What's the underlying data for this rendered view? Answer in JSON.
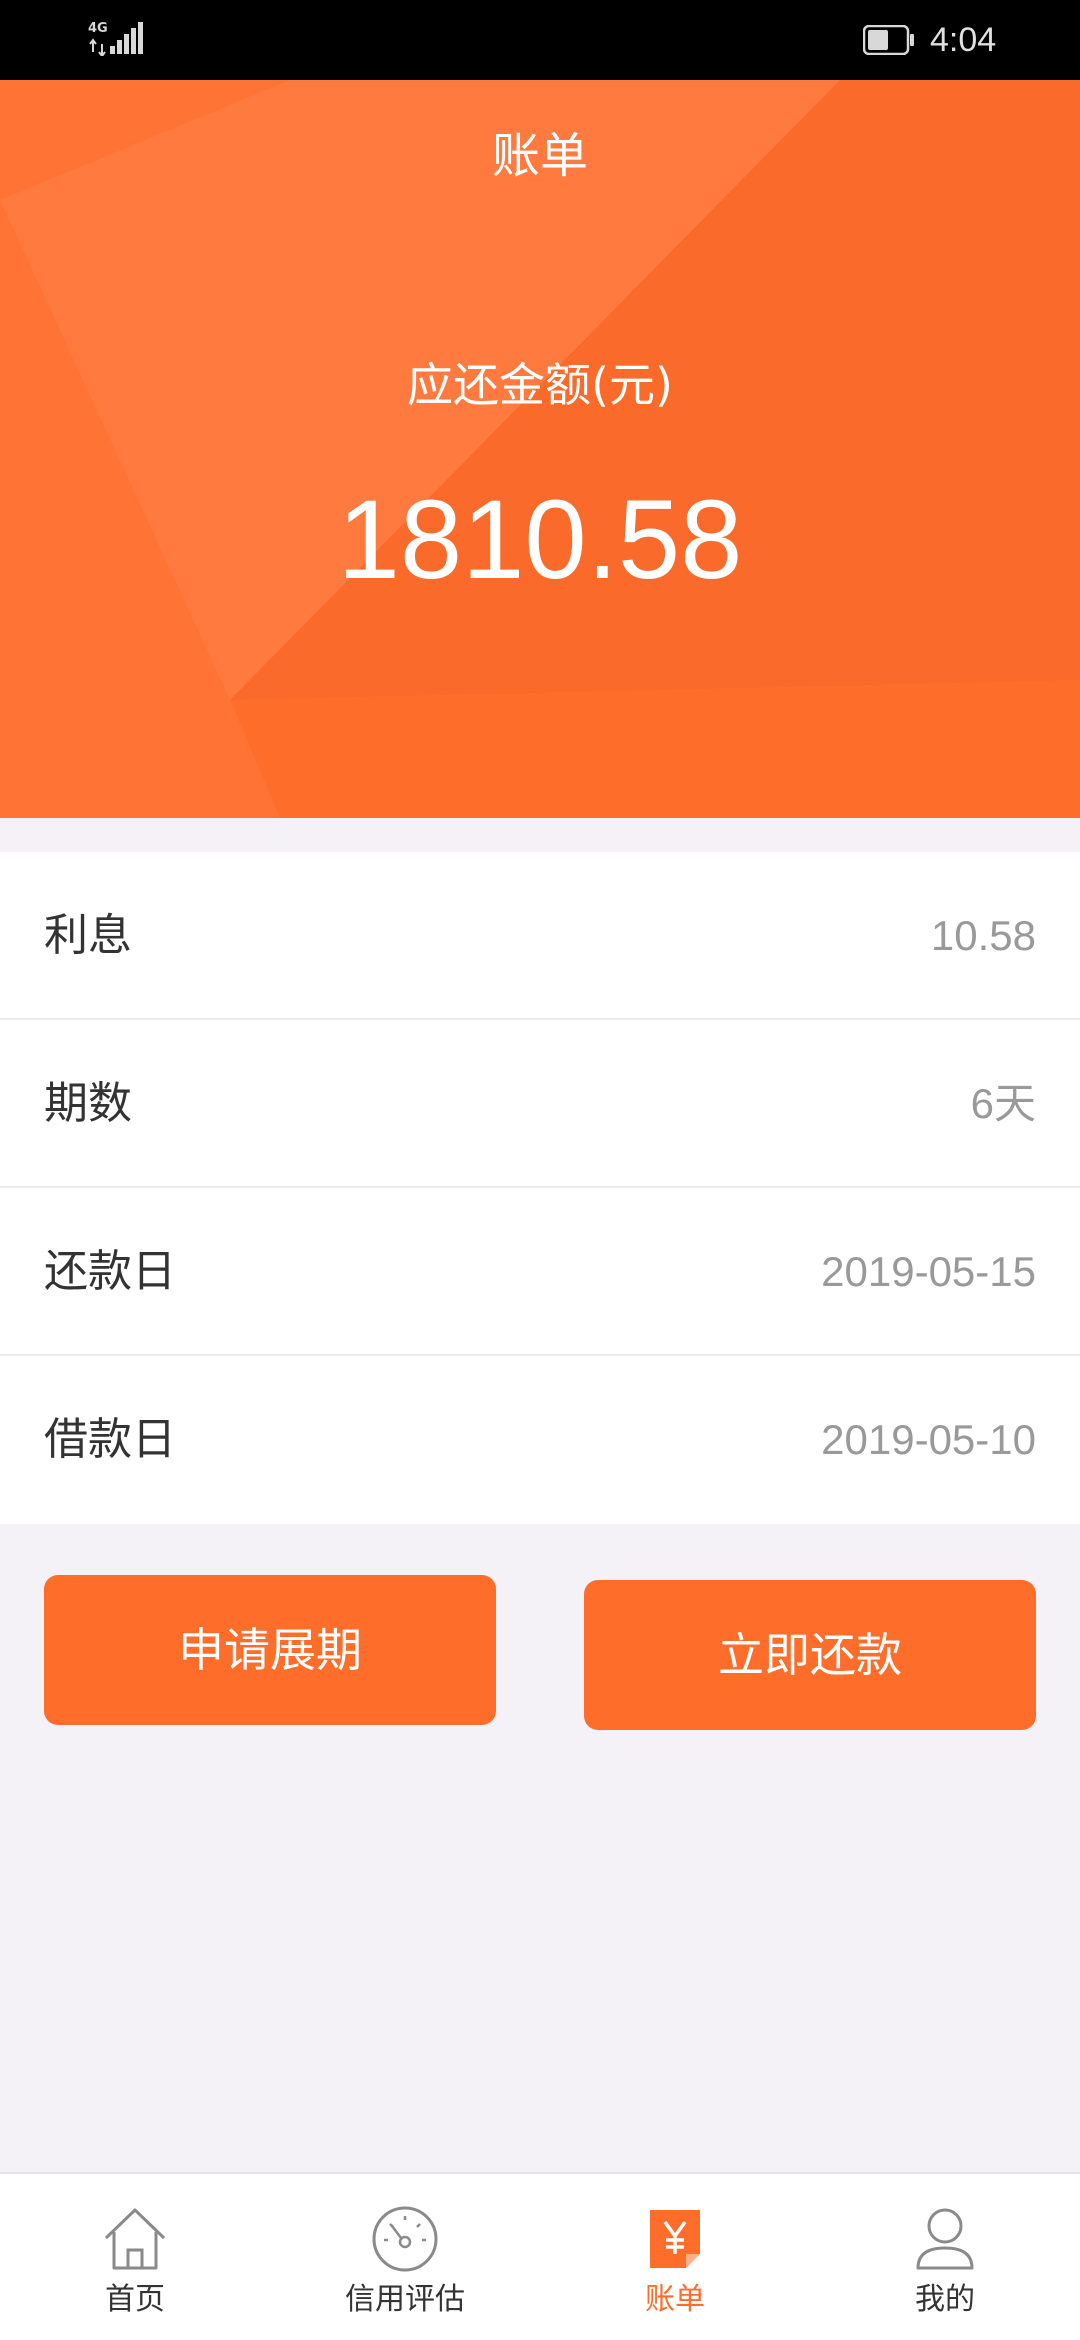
{
  "status_bar": {
    "network": "4G",
    "time": "4:04"
  },
  "header": {
    "title": "账单",
    "amount_label": "应还金额(元)",
    "amount_value": "1810.58"
  },
  "details": [
    {
      "label": "利息",
      "value": "10.58"
    },
    {
      "label": "期数",
      "value": "6天"
    },
    {
      "label": "还款日",
      "value": "2019-05-15"
    },
    {
      "label": "借款日",
      "value": "2019-05-10"
    }
  ],
  "buttons": {
    "extend": "申请展期",
    "repay": "立即还款"
  },
  "tabs": [
    {
      "label": "首页",
      "icon": "home-icon"
    },
    {
      "label": "信用评估",
      "icon": "gauge-icon"
    },
    {
      "label": "账单",
      "icon": "bill-icon",
      "active": true
    },
    {
      "label": "我的",
      "icon": "user-icon"
    }
  ],
  "colors": {
    "accent": "#ff6d2b",
    "background": "#f4f2f7",
    "label": "#333333",
    "value": "#999999"
  }
}
